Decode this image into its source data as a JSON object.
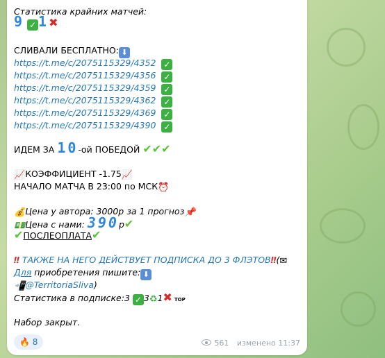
{
  "stats_title": "Статистика крайних матчей:",
  "stats_big_1": "9",
  "stats_big_2": "1",
  "leaked_title": "СЛИВАЛИ БЕСПЛАТНО:",
  "links": [
    "https://t.me/c/2075115329/4352",
    "https://t.me/c/2075115329/4356",
    "https://t.me/c/2075115329/4359",
    "https://t.me/c/2075115329/4362",
    "https://t.me/c/2075115329/4369",
    "https://t.me/c/2075115329/4390"
  ],
  "going_prefix": "ИДЕМ ЗА",
  "going_number": "10",
  "going_suffix": "-ой ПОБЕДОЙ",
  "coef": "КОЭФФИЦИЕНТ -1.75",
  "start": "НАЧАЛО МАТЧА  В 23:00 по МСК",
  "author_price": "Цена у автора: 3000р за 1 прогноз",
  "our_price_label": "Цена с нами:",
  "our_price_value": "390",
  "our_price_unit": "р",
  "postpay": "ПОСЛЕОПЛАТА",
  "subscription_note": "ТАКЖЕ НА НЕГО ДЕЙСТВУЕТ ПОДПИСКА ДО 3 ФЛЭТОВ",
  "open_paren": "(",
  "buy_prefix": "Для",
  "buy_suffix": " приобретения пишите:",
  "contact": "@TerritoriaSliva",
  "close_paren": ")",
  "sub_stats_label": "Статистика в подписке:",
  "sub_stats": [
    "3",
    "3",
    "1"
  ],
  "top_label": "TOP",
  "closed": "Набор закрыт.",
  "reaction_count": "8",
  "views": "561",
  "edited": "изменено 11:37",
  "icons": [
    "check-square-icon",
    "cross-icon",
    "down-arrow-icon",
    "chart-icon",
    "alarm-clock-icon",
    "money-bag-icon",
    "banknote-icon",
    "pushpin-icon",
    "double-exclamation-icon",
    "envelope-icon",
    "phone-icon",
    "recycle-icon",
    "fire-icon",
    "eye-icon"
  ]
}
